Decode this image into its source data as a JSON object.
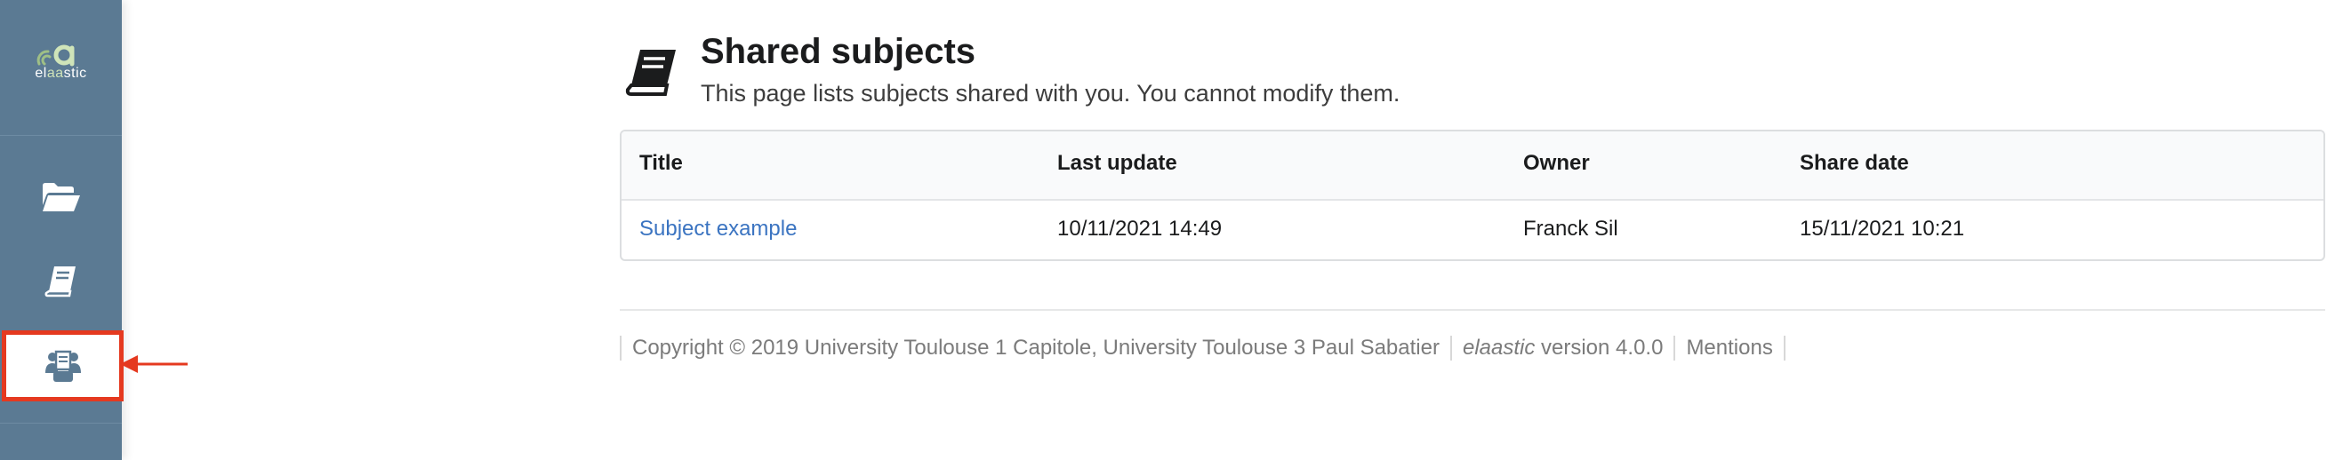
{
  "sidebar": {
    "brand": {
      "prefix": "el",
      "highlight": "aa",
      "suffix": "stic",
      "icon": "elaastic-logo"
    },
    "items": [
      {
        "icon": "folder-open-icon"
      },
      {
        "icon": "book-icon"
      },
      {
        "icon": "shared-subjects-icon",
        "active": true
      }
    ],
    "annotation_color": "#e5391f"
  },
  "header": {
    "icon": "book-icon",
    "title": "Shared subjects",
    "subtitle": "This page lists subjects shared with you. You cannot modify them."
  },
  "table": {
    "columns": [
      "Title",
      "Last update",
      "Owner",
      "Share date"
    ],
    "rows": [
      {
        "title": "Subject example",
        "last_update": "10/11/2021 14:49",
        "owner": "Franck Sil",
        "share_date": "15/11/2021 10:21"
      }
    ]
  },
  "footer": {
    "copyright": "Copyright © 2019 University Toulouse 1 Capitole, University Toulouse 3 Paul Sabatier",
    "app_name": "elaastic",
    "version_text": " version 4.0.0",
    "mentions": "Mentions"
  },
  "colors": {
    "sidebar_bg": "#5b7a93",
    "link": "#3b74c1",
    "annotation": "#e5391f"
  }
}
